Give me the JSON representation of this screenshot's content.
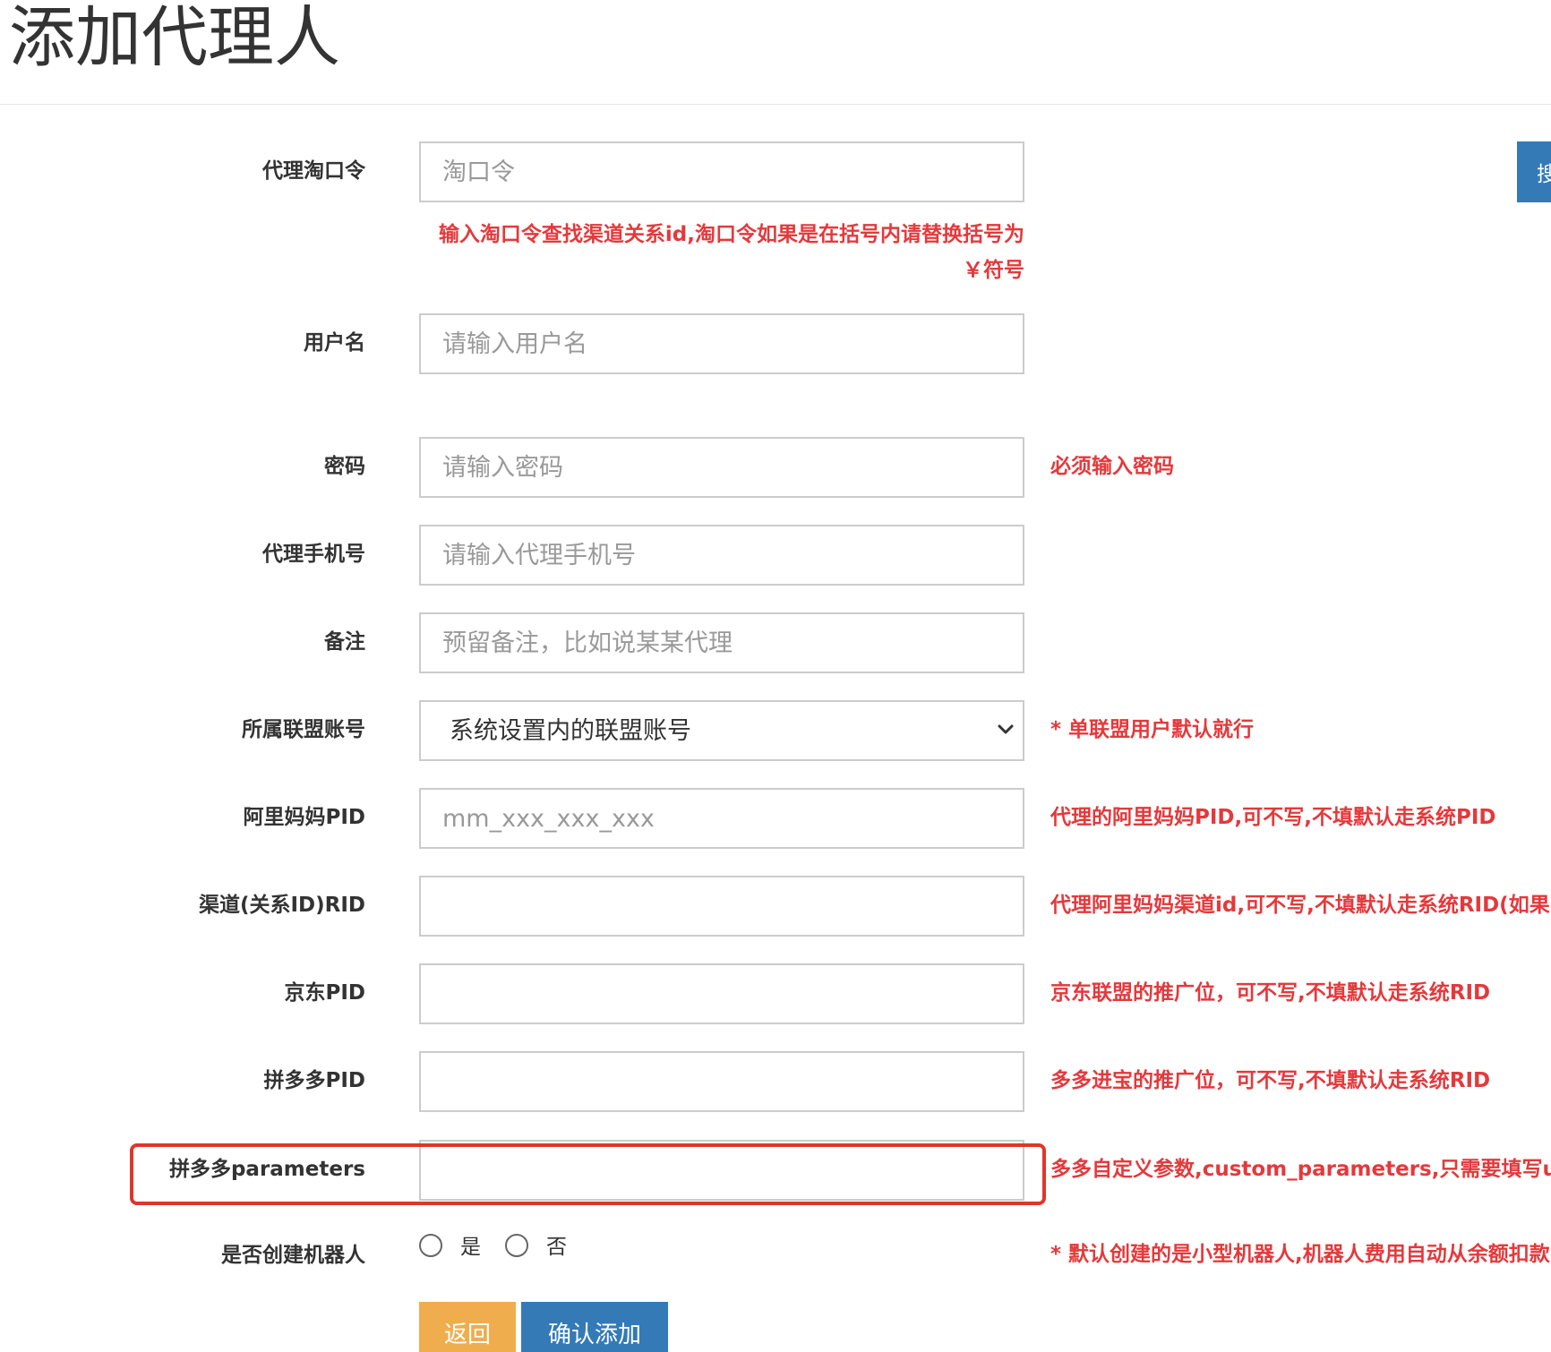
{
  "page": {
    "title": "添加代理人"
  },
  "side_button": {
    "label": "搜"
  },
  "form": {
    "taokouling": {
      "label": "代理淘口令",
      "placeholder": "淘口令",
      "hint": "输入淘口令查找渠道关系id,淘口令如果是在括号内请替换括号为￥符号"
    },
    "username": {
      "label": "用户名",
      "placeholder": "请输入用户名"
    },
    "password": {
      "label": "密码",
      "placeholder": "请输入密码",
      "hint": "必须输入密码"
    },
    "phone": {
      "label": "代理手机号",
      "placeholder": "请输入代理手机号"
    },
    "remark": {
      "label": "备注",
      "placeholder": "预留备注，比如说某某代理"
    },
    "alliance_account": {
      "label": "所属联盟账号",
      "selected": "系统设置内的联盟账号",
      "hint": "* 单联盟用户默认就行"
    },
    "alimama_pid": {
      "label": "阿里妈妈PID",
      "placeholder": "mm_xxx_xxx_xxx",
      "hint": "代理的阿里妈妈PID,可不写,不填默认走系统PID"
    },
    "channel_rid": {
      "label": "渠道(关系ID)RID",
      "placeholder": "",
      "hint": "代理阿里妈妈渠道id,可不写,不填默认走系统RID(如果"
    },
    "jd_pid": {
      "label": "京东PID",
      "placeholder": "",
      "hint": "京东联盟的推广位，可不写,不填默认走系统RID"
    },
    "pdd_pid": {
      "label": "拼多多PID",
      "placeholder": "",
      "hint": "多多进宝的推广位，可不写,不填默认走系统RID"
    },
    "pdd_parameters": {
      "label": "拼多多parameters",
      "placeholder": "",
      "hint": "多多自定义参数,custom_parameters,只需要填写uic"
    },
    "create_robot": {
      "label": "是否创建机器人",
      "option_yes": "是",
      "option_no": "否",
      "hint": "* 默认创建的是小型机器人,机器人费用自动从余额扣款"
    }
  },
  "actions": {
    "back_label": "返回",
    "confirm_label": "确认添加"
  },
  "colors": {
    "hint_red": "#e4393c",
    "highlight_border": "#e0352b",
    "primary_blue": "#337ab7",
    "warning_orange": "#f0ad4e"
  }
}
